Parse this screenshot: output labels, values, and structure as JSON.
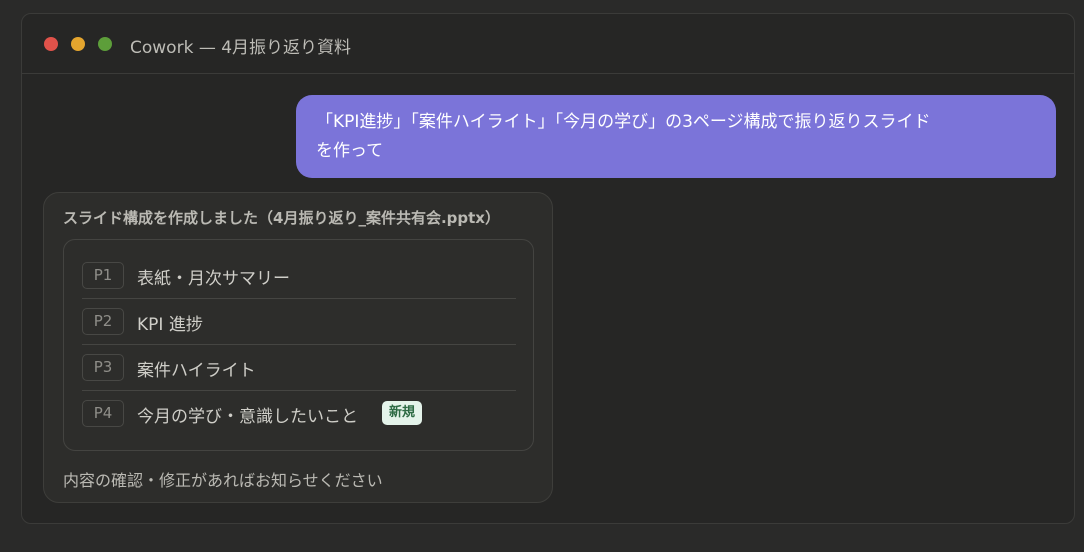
{
  "window": {
    "title": "Cowork — 4月振り返り資料",
    "traffic_lights": {
      "close_color": "#e0524a",
      "minimize_color": "#e4a52e",
      "zoom_color": "#5d9e3a"
    }
  },
  "conversation": {
    "user_message": {
      "line1": "「KPI進捗」「案件ハイライト」「今月の学び」の3ページ構成で振り返りスライド",
      "line2": "を作って",
      "bubble_color": "#7b74d9"
    },
    "assistant_message": {
      "heading": "スライド構成を作成しました（4月振り返り_案件共有会.pptx）",
      "slides": [
        {
          "page": "P1",
          "title": "表紙・月次サマリー"
        },
        {
          "page": "P2",
          "title": "KPI 進捗"
        },
        {
          "page": "P3",
          "title": "案件ハイライト"
        },
        {
          "page": "P4",
          "title": "今月の学び・意識したいこと",
          "badge": "新規"
        }
      ],
      "footer": "内容の確認・修正があればお知らせください"
    }
  }
}
